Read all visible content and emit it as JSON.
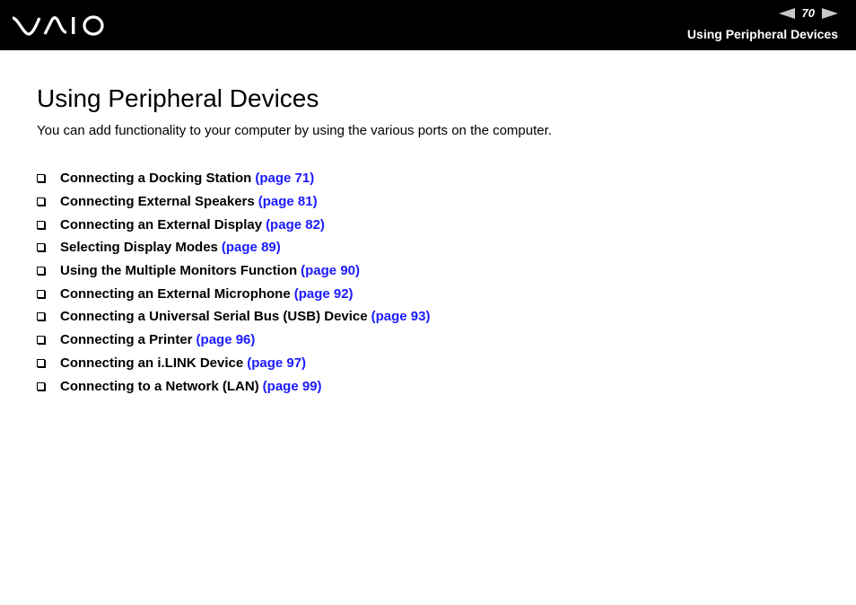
{
  "header": {
    "logo": "VAIO",
    "page_number": "70",
    "section_title": "Using Peripheral Devices",
    "prev_icon": "left-triangle-arrow",
    "next_icon": "right-triangle-arrow"
  },
  "main": {
    "title": "Using Peripheral Devices",
    "intro": "You can add functionality to your computer by using the various ports on the computer.",
    "items": [
      {
        "label": "Connecting a Docking Station",
        "link": "(page 71)"
      },
      {
        "label": "Connecting External Speakers",
        "link": "(page 81)"
      },
      {
        "label": "Connecting an External Display",
        "link": "(page 82)"
      },
      {
        "label": "Selecting Display Modes",
        "link": "(page 89)"
      },
      {
        "label": "Using the Multiple Monitors Function",
        "link": "(page 90)"
      },
      {
        "label": "Connecting an External Microphone",
        "link": "(page 92)"
      },
      {
        "label": "Connecting a Universal Serial Bus (USB) Device",
        "link": "(page 93)"
      },
      {
        "label": "Connecting a Printer",
        "link": "(page 96)"
      },
      {
        "label": "Connecting an i.LINK Device",
        "link": "(page 97)"
      },
      {
        "label": "Connecting to a Network (LAN)",
        "link": "(page 99)"
      }
    ]
  },
  "colors": {
    "header_bg": "#000000",
    "link": "#1a1aff",
    "arrow": "#c8c8c8"
  }
}
